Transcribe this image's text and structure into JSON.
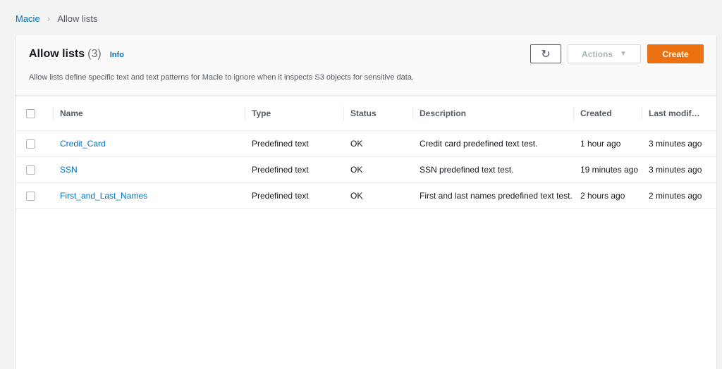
{
  "breadcrumb": {
    "root": "Macie",
    "current": "Allow lists"
  },
  "header": {
    "title": "Allow lists",
    "count": "(3)",
    "info": "Info",
    "description": "Allow lists define specific text and text patterns for Macie to ignore when it inspects S3 objects for sensitive data.",
    "actions": "Actions",
    "create": "Create"
  },
  "table": {
    "columns": [
      "Name",
      "Type",
      "Status",
      "Description",
      "Created",
      "Last modif…"
    ],
    "rows": [
      [
        "Credit_Card",
        "Predefined text",
        "OK",
        "Credit card predefined text test.",
        "1 hour ago",
        "3 minutes ago"
      ],
      [
        "SSN",
        "Predefined text",
        "OK",
        "SSN predefined text test.",
        "19 minutes ago",
        "3 minutes ago"
      ],
      [
        "First_and_Last_Names",
        "Predefined text",
        "OK",
        "First and last names predefined text test.",
        "2 hours ago",
        "2 minutes ago"
      ]
    ]
  },
  "colors": {
    "accent": "#ec7211",
    "link": "#0073bb"
  }
}
